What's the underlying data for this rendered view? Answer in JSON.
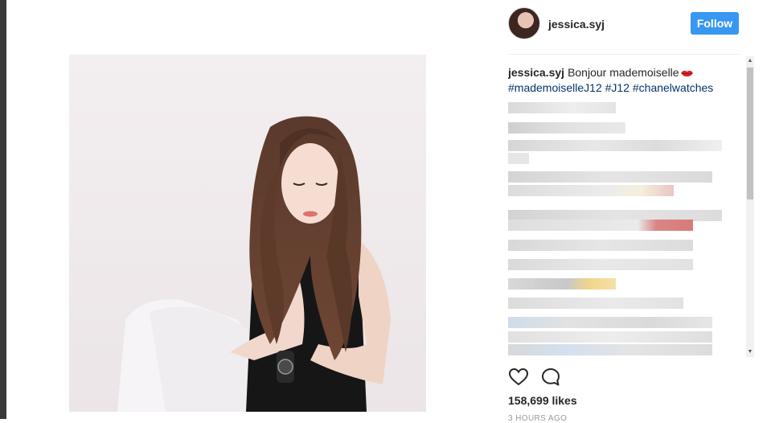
{
  "post": {
    "username": "jessica.syj",
    "follow_label": "Follow",
    "caption_user": "jessica.syj",
    "caption_text": "Bonjour mademoiselle",
    "hashtags": [
      "#mademoiselleJ12",
      "#J12",
      "#chanelwatches"
    ],
    "likes": "158,699 likes",
    "time_ago": "3 HOURS AGO"
  },
  "icons": {
    "lips": "lips-emoji-icon",
    "like": "heart-icon",
    "comment": "comment-bubble-icon",
    "scroll_up": "scroll-up-arrow-icon",
    "scroll_down": "scroll-down-arrow-icon"
  },
  "colors": {
    "follow_button": "#3897f0",
    "hashtag": "#003569",
    "text": "#262626",
    "muted": "#999999"
  }
}
